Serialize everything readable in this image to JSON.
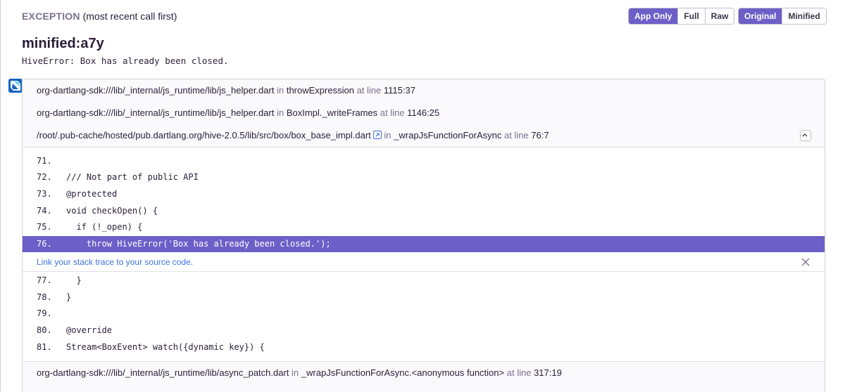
{
  "header": {
    "label_caps": "EXCEPTION",
    "label_sub": "(most recent call first)",
    "mode_buttons": [
      "App Only",
      "Full",
      "Raw"
    ],
    "view_buttons": [
      "Original",
      "Minified"
    ]
  },
  "exception": {
    "type": "minified:a7y",
    "value": "HiveError: Box has already been closed."
  },
  "frames": [
    {
      "file": "org-dartlang-sdk:///lib/_internal/js_runtime/lib/js_helper.dart",
      "in": "in",
      "function": "throwExpression",
      "at_line": "at line",
      "line": "1115:37"
    },
    {
      "file": "org-dartlang-sdk:///lib/_internal/js_runtime/lib/js_helper.dart",
      "in": "in",
      "function": "BoxImpl._writeFrames",
      "at_line": "at line",
      "line": "1146:25"
    },
    {
      "file": "/root/.pub-cache/hosted/pub.dartlang.org/hive-2.0.5/lib/src/box/box_base_impl.dart",
      "in": "in",
      "function": "_wrapJsFunctionForAsync",
      "at_line": "at line",
      "line": "76:7"
    },
    {
      "file": "org-dartlang-sdk:///lib/_internal/js_runtime/lib/async_patch.dart",
      "in": "in",
      "function": "_wrapJsFunctionForAsync.<anonymous function>",
      "at_line": "at line",
      "line": "317:19"
    }
  ],
  "context_before": [
    {
      "num": "71.",
      "code": ""
    },
    {
      "num": "72.",
      "code": "/// Not part of public API"
    },
    {
      "num": "73.",
      "code": "@protected"
    },
    {
      "num": "74.",
      "code": "void checkOpen() {"
    },
    {
      "num": "75.",
      "code": "  if (!_open) {"
    },
    {
      "num": "76.",
      "code": "    throw HiveError('Box has already been closed.');"
    }
  ],
  "link_banner": "Link your stack trace to your source code.",
  "context_after": [
    {
      "num": "77.",
      "code": "  }"
    },
    {
      "num": "78.",
      "code": "}"
    },
    {
      "num": "79.",
      "code": ""
    },
    {
      "num": "80.",
      "code": "@override"
    },
    {
      "num": "81.",
      "code": "Stream<BoxEvent> watch({dynamic key}) {"
    }
  ],
  "colors": {
    "accent": "#6c5fc7",
    "link": "#3d74db"
  }
}
